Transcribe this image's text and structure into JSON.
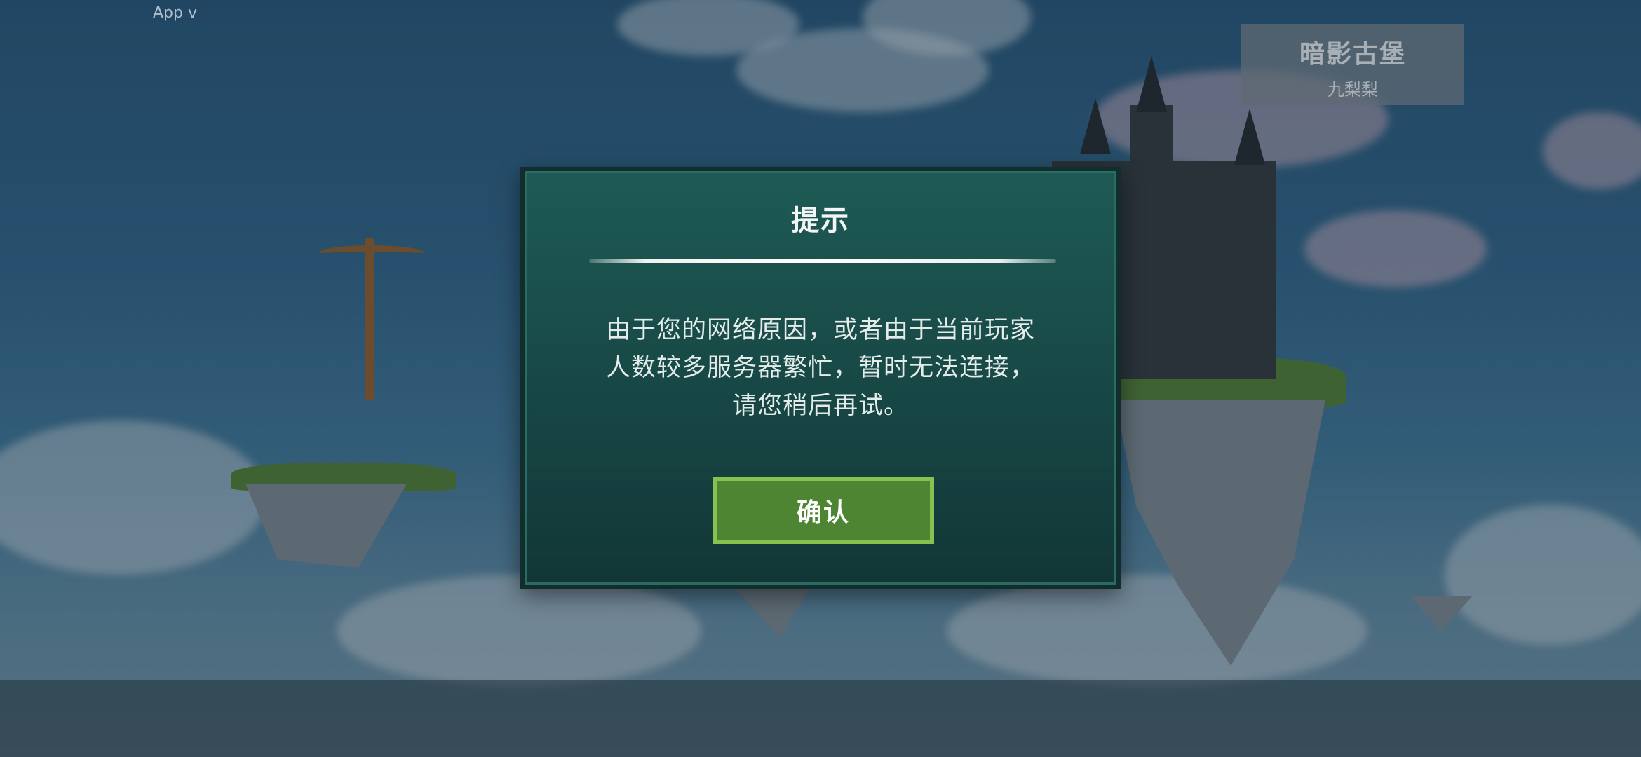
{
  "app_version_label": "App v",
  "server": {
    "name": "暗影古堡",
    "subtitle": "九梨梨"
  },
  "dialog": {
    "title": "提示",
    "message": "由于您的网络原因，或者由于当前玩家人数较多服务器繁忙，暂时无法连接，请您稍后再试。",
    "confirm_label": "确认"
  },
  "colors": {
    "dialog_bg": "#174745",
    "confirm_bg": "#4e8532",
    "confirm_border": "#86c24f"
  }
}
